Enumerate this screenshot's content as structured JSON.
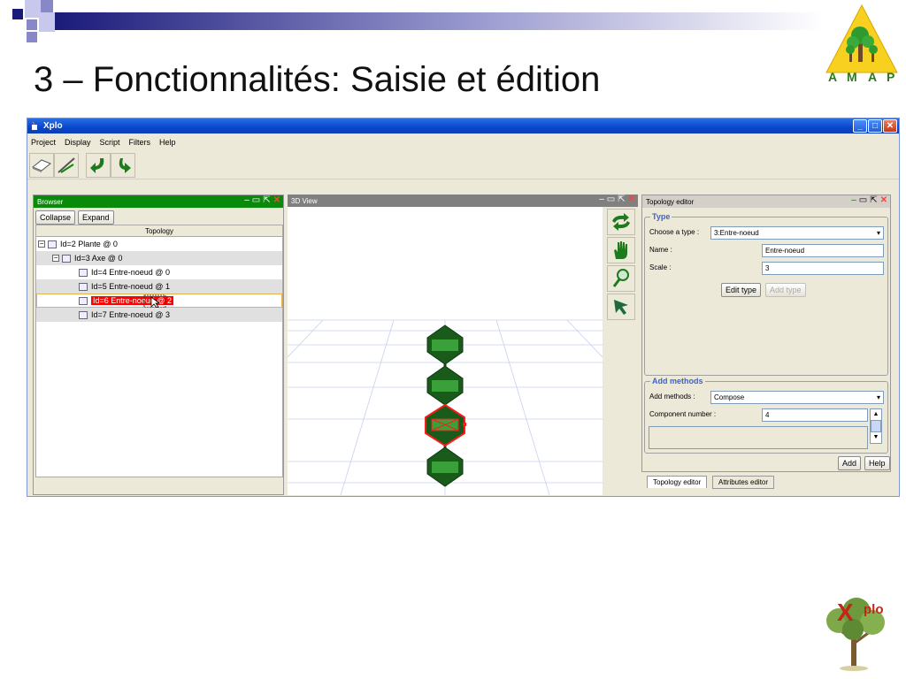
{
  "slide": {
    "title": "3 – Fonctionnalités: Saisie et édition",
    "logo_top": {
      "letters": [
        "A",
        "M",
        "A",
        "P"
      ]
    },
    "logo_bottom": {
      "text": "plo",
      "big": "X"
    },
    "colors": {
      "deco_dark": "#1a1a7a",
      "deco_light": "#8888c8",
      "amap_yellow": "#f7d020",
      "amap_green": "#2e9b2e",
      "amap_text": "#2b7a1f"
    }
  },
  "app": {
    "window_title": "Xplo",
    "menu": [
      "Project",
      "Display",
      "Script",
      "Filters",
      "Help"
    ],
    "toolbar": [
      "eraser-icon",
      "scissors-icon",
      "undo-icon",
      "redo-icon"
    ],
    "browser": {
      "title": "Browser",
      "buttons": [
        "Collapse",
        "Expand"
      ],
      "column": "Topology",
      "rows": [
        {
          "label": "Id=2 Plante @ 0",
          "depth": 0,
          "expander": "−"
        },
        {
          "label": "Id=3 Axe @ 0",
          "depth": 1,
          "expander": "−"
        },
        {
          "label": "Id=4 Entre-noeud @ 0",
          "depth": 2
        },
        {
          "label": "Id=5 Entre-noeud @ 1",
          "depth": 2
        },
        {
          "label": "Id=6 Entre-noeud @ 2",
          "depth": 2,
          "selected": true
        },
        {
          "label": "Id=7 Entre-noeud @ 3",
          "depth": 2
        }
      ]
    },
    "view3d": {
      "title": "3D View",
      "tools": [
        "rotate-icon",
        "hand-icon",
        "zoom-icon",
        "select-arrow-icon"
      ]
    },
    "topology_editor": {
      "title": "Topology editor",
      "type_legend": "Type",
      "choose_type_label": "Choose a type :",
      "choose_type_value": "3:Entre-noeud",
      "name_label": "Name :",
      "name_value": "Entre-noeud",
      "scale_label": "Scale :",
      "scale_value": "3",
      "edit_type": "Edit type",
      "add_type": "Add type",
      "methods_legend": "Add methods",
      "add_methods_label": "Add methods :",
      "add_methods_value": "Compose",
      "component_label": "Component number :",
      "component_value": "4",
      "add": "Add",
      "help": "Help",
      "tabs": [
        "Topology editor",
        "Attributes editor"
      ]
    }
  }
}
